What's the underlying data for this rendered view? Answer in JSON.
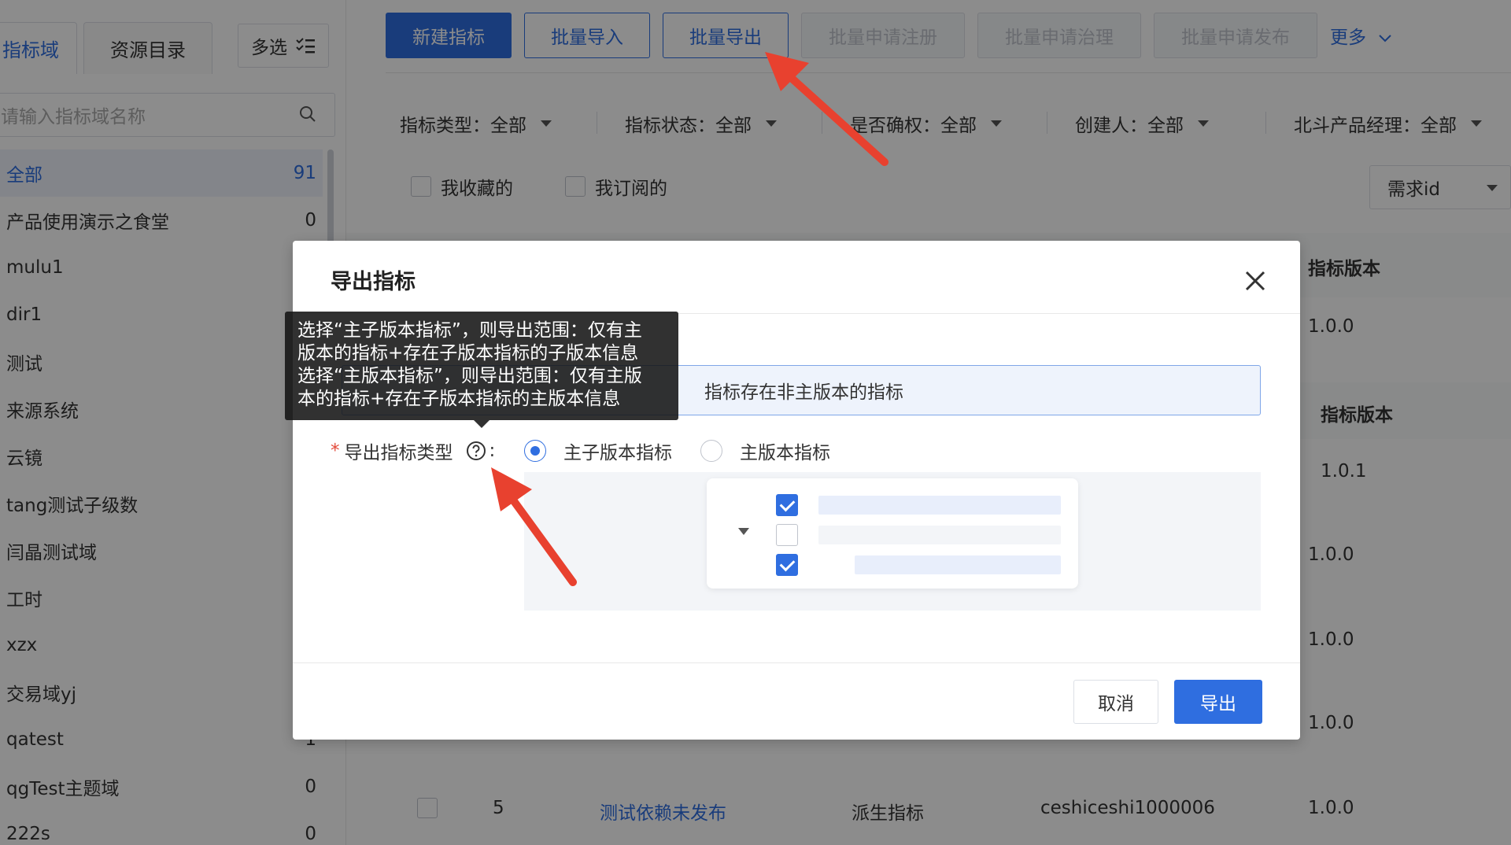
{
  "sidebar": {
    "tabs": [
      {
        "label": "指标域",
        "active": true
      },
      {
        "label": "资源目录",
        "active": false
      }
    ],
    "multi_select_label": "多选",
    "search_placeholder": "请输入指标域名称",
    "items": [
      {
        "label": "全部",
        "count": "91",
        "active": true
      },
      {
        "label": "产品使用演示之食堂",
        "count": "0"
      },
      {
        "label": "mulu1",
        "count": ""
      },
      {
        "label": "dir1",
        "count": ""
      },
      {
        "label": "测试",
        "count": ""
      },
      {
        "label": "来源系统",
        "count": ""
      },
      {
        "label": "云镜",
        "count": ""
      },
      {
        "label": "tang测试子级数",
        "count": ""
      },
      {
        "label": "闫晶测试域",
        "count": ""
      },
      {
        "label": "工时",
        "count": ""
      },
      {
        "label": "xzx",
        "count": ""
      },
      {
        "label": "交易域yj",
        "count": ""
      },
      {
        "label": "qatest",
        "count": "1"
      },
      {
        "label": "qgTest主题域",
        "count": "0"
      },
      {
        "label": "222s",
        "count": "0"
      }
    ]
  },
  "toolbar": {
    "new_label": "新建指标",
    "import_label": "批量导入",
    "export_label": "批量导出",
    "apply_register_label": "批量申请注册",
    "apply_govern_label": "批量申请治理",
    "apply_publish_label": "批量申请发布",
    "more_label": "更多"
  },
  "filters": [
    {
      "label": "指标类型：全部"
    },
    {
      "label": "指标状态：全部"
    },
    {
      "label": "是否确权：全部"
    },
    {
      "label": "创建人：全部"
    },
    {
      "label": "北斗产品经理：全部"
    }
  ],
  "checks": {
    "favorite_label": "我收藏的",
    "subscribed_label": "我订阅的"
  },
  "select": {
    "value": "需求id"
  },
  "table": {
    "version_header": "指标版本",
    "version_header_2": "指标版本",
    "versions": [
      "1.0.0",
      "1.0.1",
      "1.0.0",
      "1.0.0",
      "1.0.0"
    ],
    "last_row": {
      "index": "5",
      "name": "测试依赖未发布",
      "type": "派生指标",
      "code": "ceshiceshi1000006",
      "version": "1.0.0"
    }
  },
  "modal": {
    "title": "导出指标",
    "info_text": "指标存在非主版本的指标",
    "field_label": "导出指标类型",
    "field_colon": ":",
    "options": [
      {
        "label": "主子版本指标",
        "checked": true
      },
      {
        "label": "主版本指标",
        "checked": false
      }
    ],
    "cancel_label": "取消",
    "export_label": "导出"
  },
  "tooltip": {
    "line1": "选择“主子版本指标”，则导出范围：仅有主",
    "line2": "版本的指标+存在子版本指标的子版本信息",
    "line3": "选择“主版本指标”，则导出范围：仅有主版",
    "line4": "本的指标+存在子版本指标的主版本信息"
  },
  "colors": {
    "primary": "#2f6ee0",
    "annotation_arrow": "#e8412f"
  }
}
